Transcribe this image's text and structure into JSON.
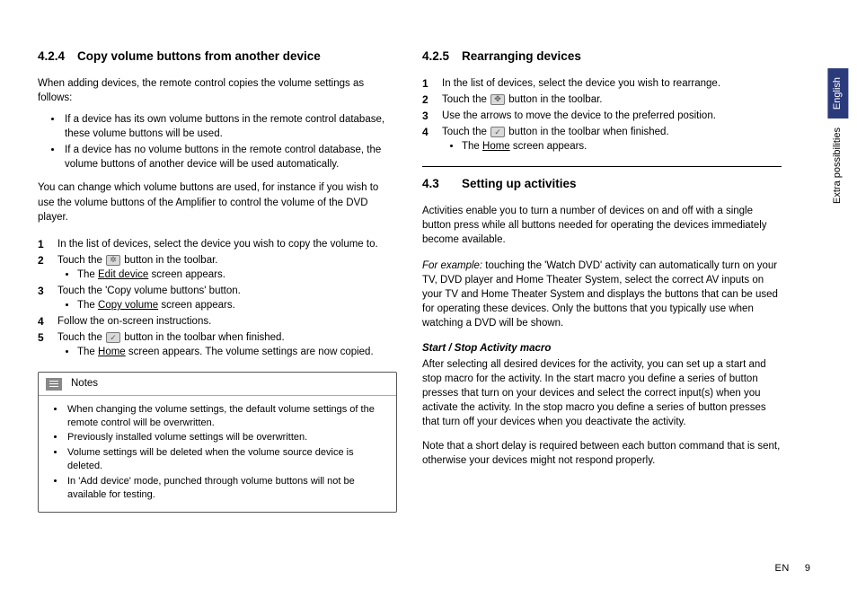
{
  "sideTabs": {
    "lang": "English",
    "section": "Extra possibilities"
  },
  "footer": {
    "lang": "EN",
    "page": "9"
  },
  "left": {
    "h424_num": "4.2.4",
    "h424_title": "Copy volume buttons from another device",
    "intro": "When adding devices, the remote control copies the volume settings as follows:",
    "introBullets": [
      "If a device has its own volume buttons in the remote control database, these volume buttons will be used.",
      "If a device has no volume buttons in the remote control database, the volume buttons of another device will be used automatically."
    ],
    "para2": "You can change which volume buttons are used, for instance if you wish to use the volume buttons of the Amplifier to control the volume of the DVD player.",
    "steps": {
      "s1": "In the list of devices, select the device you wish to copy the volume to.",
      "s2a": "Touch the ",
      "s2b": " button in the toolbar.",
      "s2sub_pre": "The ",
      "s2sub_key": "Edit device",
      "s2sub_post": " screen appears.",
      "s3": "Touch the 'Copy volume buttons' button.",
      "s3sub_pre": "The ",
      "s3sub_key": "Copy volume",
      "s3sub_post": " screen appears.",
      "s4": "Follow the on-screen instructions.",
      "s5a": "Touch the ",
      "s5b": " button in the toolbar when finished.",
      "s5sub_pre": "The ",
      "s5sub_key": "Home",
      "s5sub_post": " screen appears. The volume settings are now copied."
    },
    "notesLabel": "Notes",
    "notes": [
      "When changing the volume settings, the default volume settings of the remote control will be overwritten.",
      "Previously installed volume settings will be overwritten.",
      "Volume settings will be deleted when the volume source device is deleted.",
      "In 'Add device' mode, punched through volume buttons will not be available for testing."
    ]
  },
  "right": {
    "h425_num": "4.2.5",
    "h425_title": "Rearranging devices",
    "r_steps": {
      "s1": "In the list of devices, select the device you wish to rearrange.",
      "s2a": "Touch the ",
      "s2b": " button in the toolbar.",
      "s3": "Use the arrows to move the device to the preferred position.",
      "s4a": "Touch the ",
      "s4b": " button in the toolbar when finished.",
      "s4sub_pre": "The ",
      "s4sub_key": "Home",
      "s4sub_post": " screen appears."
    },
    "h43_num": "4.3",
    "h43_title": "Setting up activities",
    "act_p1": "Activities enable you to turn a number of devices on and off with a single button press while all buttons needed for operating the devices immediately become available.",
    "act_eg_lead": "For example:",
    "act_eg_rest": " touching the 'Watch DVD' activity can automatically turn on your TV, DVD player and Home Theater System, select the correct AV inputs on your TV and Home Theater System and displays the buttons that can be used for operating these devices. Only the buttons that you typically use when watching a DVD will be shown.",
    "macro_head": "Start / Stop Activity macro",
    "macro_p1": "After selecting all desired devices for the activity, you can set up a start and stop macro for the activity. In the start macro you define a series of button presses that turn on your devices and select the correct input(s) when you activate the activity. In the stop macro you define a series of button presses that turn off your devices when you deactivate the activity.",
    "macro_p2": "Note that a short delay is required between each button command that is sent, otherwise your devices might not respond properly."
  }
}
